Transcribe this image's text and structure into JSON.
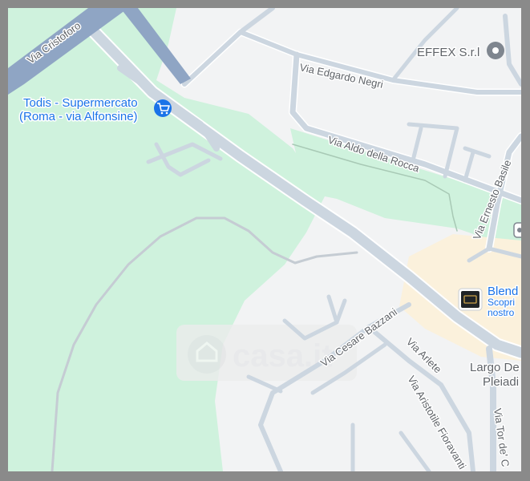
{
  "map": {
    "colors": {
      "land": "#f2f3f4",
      "park": "#cff2dd",
      "commercial": "#fbf1dc",
      "road": "#ccd6e0",
      "road_outline": "#ffffff",
      "highway": "#8fa5c4",
      "poi_blue": "#1a73e8",
      "label_gray": "#5f6368"
    },
    "streets": {
      "via_cristoforo": "Via Cristoforo",
      "via_edgardo_negri": "Via Edgardo Negri",
      "via_aldo_della_rocca": "Via Aldo della Rocca",
      "via_ernesto_basile": "Via Ernesto Basile",
      "via_cesare_bazzani": "Via Cesare Bazzani",
      "via_arlete": "Via Arlete",
      "via_aristotile_fioravanti": "Via Aristotile Fioravanti",
      "via_tor_de": "Via Tor de' C"
    },
    "places": {
      "todis_line1": "Todis - Supermercato",
      "todis_line2": "(Roma - via Alfonsine)",
      "effex": "EFFEX S.r.l",
      "blend_name": "Blend",
      "blend_sub1": "Scopri",
      "blend_sub2": "nostro",
      "largo_line1": "Largo De",
      "largo_line2": "Pleiadi"
    },
    "icons": {
      "todis": "shopping-cart-icon",
      "effex": "place-pin-icon",
      "blend": "venue-logo-icon",
      "edge": "poi-edge-icon"
    },
    "watermark": "casa.it"
  }
}
